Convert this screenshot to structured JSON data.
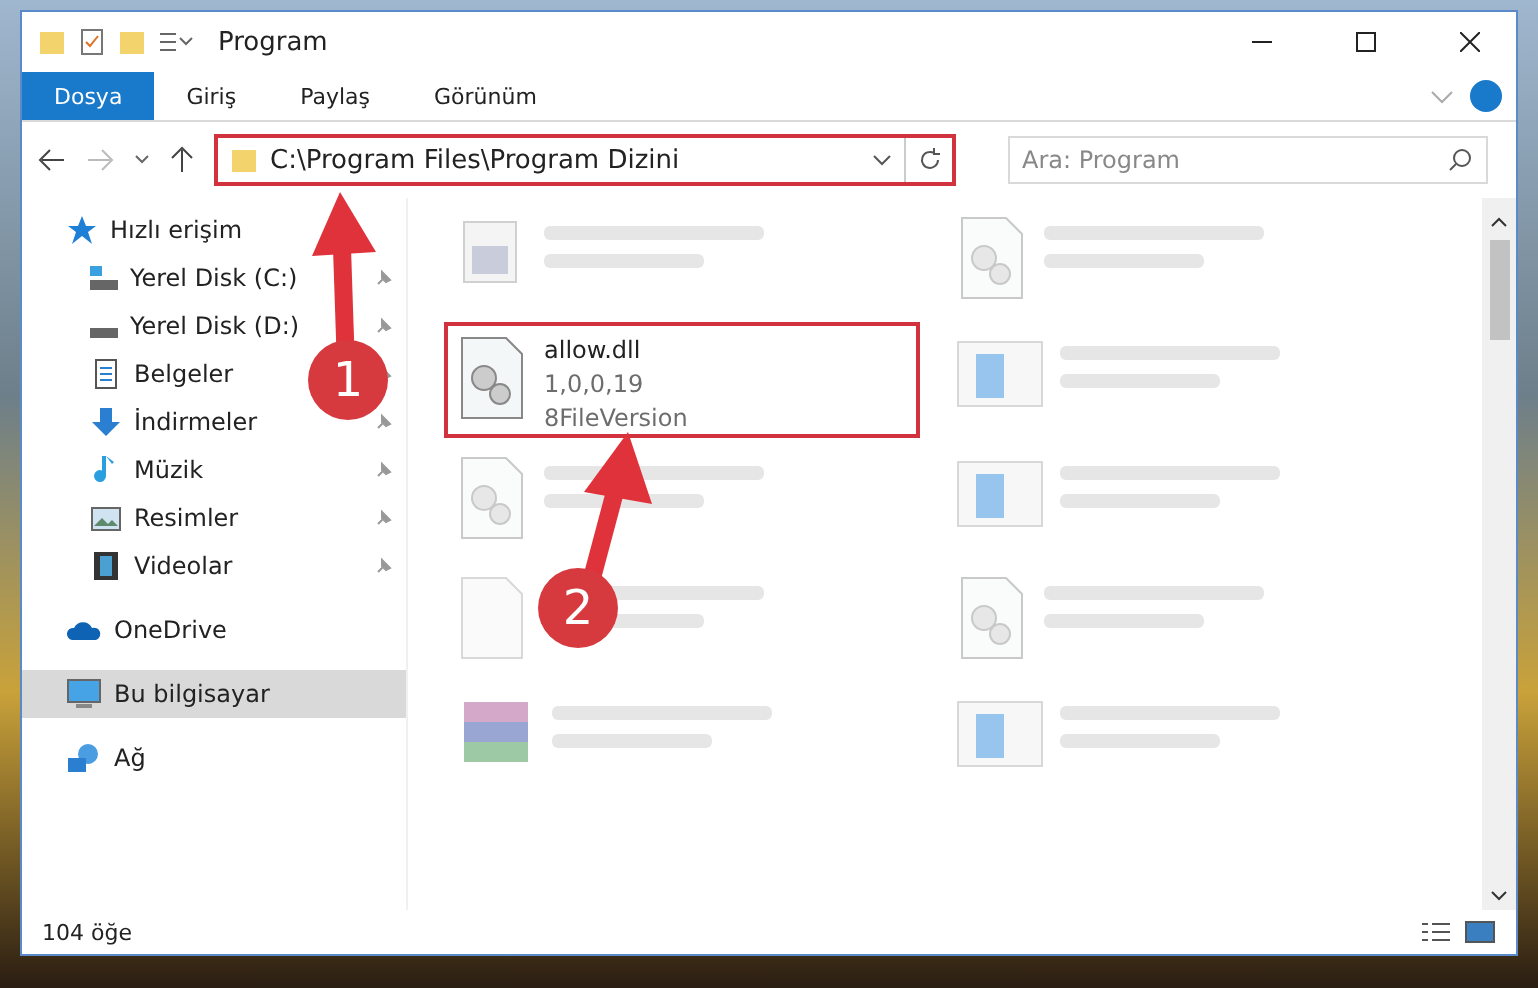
{
  "window": {
    "title": "Program"
  },
  "ribbon_tabs": [
    {
      "label": "Dosya",
      "kind": "file"
    },
    {
      "label": "Giriş",
      "kind": "tab"
    },
    {
      "label": "Paylaş",
      "kind": "tab"
    },
    {
      "label": "Görünüm",
      "kind": "tab"
    }
  ],
  "address": {
    "path": "C:\\Program Files\\Program Dizini"
  },
  "search": {
    "placeholder": "Ara: Program"
  },
  "sidebar": [
    {
      "label": "Hızlı erişim",
      "kind": "star",
      "selected": false,
      "children": [
        {
          "label": "Yerel Disk (C:)",
          "kind": "drive-c",
          "pinned": true
        },
        {
          "label": "Yerel Disk (D:)",
          "kind": "drive",
          "pinned": true
        },
        {
          "label": "Belgeler",
          "kind": "docs",
          "pinned": true
        },
        {
          "label": "İndirmeler",
          "kind": "download",
          "pinned": true
        },
        {
          "label": "Müzik",
          "kind": "music",
          "pinned": true
        },
        {
          "label": "Resimler",
          "kind": "pictures",
          "pinned": true
        },
        {
          "label": "Videolar",
          "kind": "video",
          "pinned": true
        }
      ]
    },
    {
      "label": "OneDrive",
      "kind": "cloud",
      "selected": false
    },
    {
      "label": "Bu bilgisayar",
      "kind": "pc",
      "selected": true
    },
    {
      "label": "Ağ",
      "kind": "network",
      "selected": false
    }
  ],
  "files": [
    {
      "kind": "exe",
      "faded": true,
      "highlighted": false
    },
    {
      "kind": "dll",
      "faded": true,
      "highlighted": false
    },
    {
      "name": "allow.dll",
      "lines": [
        "1,0,0,19",
        "8FileVersion"
      ],
      "kind": "dll",
      "faded": false,
      "highlighted": true
    },
    {
      "kind": "app",
      "faded": true,
      "highlighted": false
    },
    {
      "kind": "dll",
      "faded": true,
      "highlighted": false
    },
    {
      "kind": "app",
      "faded": true,
      "highlighted": false
    },
    {
      "kind": "blank",
      "faded": true,
      "highlighted": false
    },
    {
      "kind": "dll",
      "faded": true,
      "highlighted": false
    },
    {
      "kind": "archive",
      "faded": true,
      "highlighted": false
    },
    {
      "kind": "app",
      "faded": true,
      "highlighted": false
    }
  ],
  "status_bar": {
    "count": "104 öğe"
  },
  "annotations": [
    {
      "label": "1"
    },
    {
      "label": "2"
    }
  ]
}
